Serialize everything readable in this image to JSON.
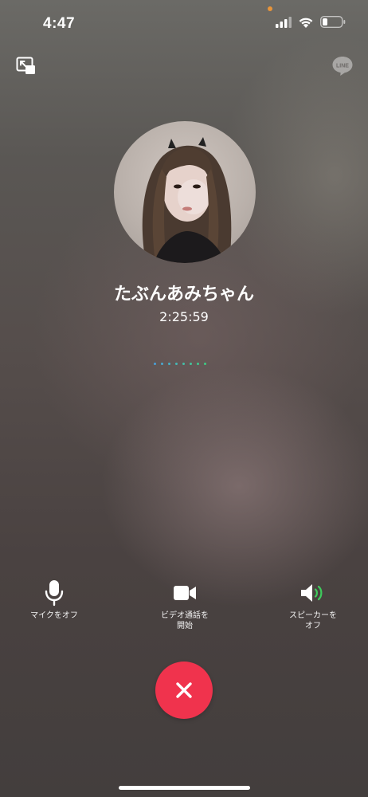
{
  "status_bar": {
    "time": "4:47",
    "signal_icon": "cellular-signal-icon",
    "wifi_icon": "wifi-icon",
    "battery_icon": "battery-icon"
  },
  "top_bar": {
    "pip_icon": "minimize-window-icon",
    "logo_text": "LINE"
  },
  "caller": {
    "name": "たぶんあみちゃん",
    "duration": "2:25:59"
  },
  "audio_indicator": {
    "dot_colors": [
      "#4aa0d8",
      "#4aa8d0",
      "#48b0c4",
      "#46b8b6",
      "#44c0a8",
      "#42c59c",
      "#40c890",
      "#3ecb84"
    ]
  },
  "controls": {
    "mic_label": "マイクをオフ",
    "video_label": "ビデオ通話を\n開始",
    "speaker_label": "スピーカーを\nオフ"
  },
  "colors": {
    "end_call": "#f0334d",
    "speaker_wave": "#3ecb5c"
  }
}
